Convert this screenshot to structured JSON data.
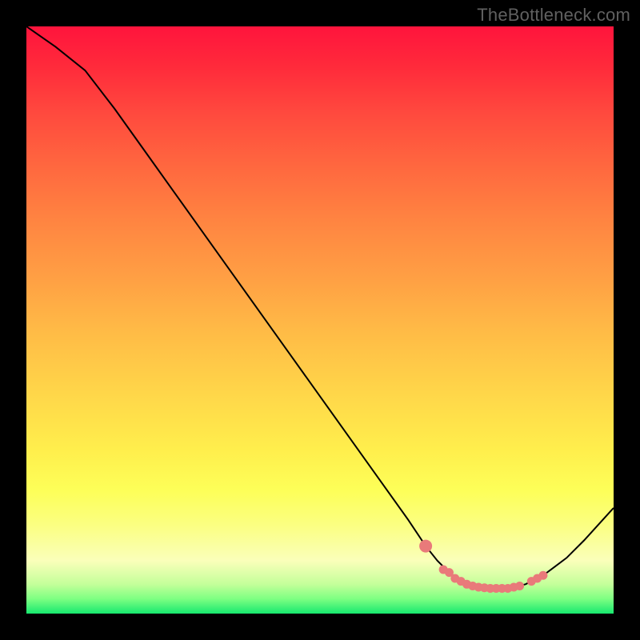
{
  "watermark": "TheBottleneck.com",
  "colors": {
    "frame_bg": "#000000",
    "curve_stroke": "#000000",
    "dot_fill": "#e97a7a",
    "gradient_top": "#ff143c",
    "gradient_bottom": "#17e86f"
  },
  "chart_data": {
    "type": "line",
    "title": "",
    "xlabel": "",
    "ylabel": "",
    "xlim": [
      0,
      100
    ],
    "ylim": [
      0,
      100
    ],
    "x": [
      0,
      5,
      10,
      15,
      20,
      25,
      30,
      35,
      40,
      45,
      50,
      55,
      60,
      65,
      68,
      70,
      72,
      74,
      75,
      76,
      77,
      78,
      79,
      80,
      81,
      82,
      83,
      85,
      87,
      88,
      90,
      92,
      95,
      100
    ],
    "values": [
      100,
      96.5,
      92.5,
      86,
      79,
      72,
      65,
      58,
      51,
      44,
      37,
      30,
      23,
      16,
      11.5,
      9,
      7,
      5.5,
      5,
      4.7,
      4.5,
      4.4,
      4.3,
      4.3,
      4.3,
      4.3,
      4.5,
      5,
      6,
      6.5,
      8,
      9.5,
      12.5,
      18
    ],
    "highlight_points": {
      "x": [
        68,
        71,
        72,
        73,
        74,
        75,
        76,
        77,
        78,
        79,
        80,
        81,
        82,
        83,
        84,
        86,
        87,
        88
      ],
      "y": [
        11.5,
        7.5,
        7,
        6,
        5.5,
        5,
        4.7,
        4.5,
        4.4,
        4.3,
        4.3,
        4.3,
        4.3,
        4.5,
        4.7,
        5.5,
        6,
        6.5
      ]
    }
  }
}
